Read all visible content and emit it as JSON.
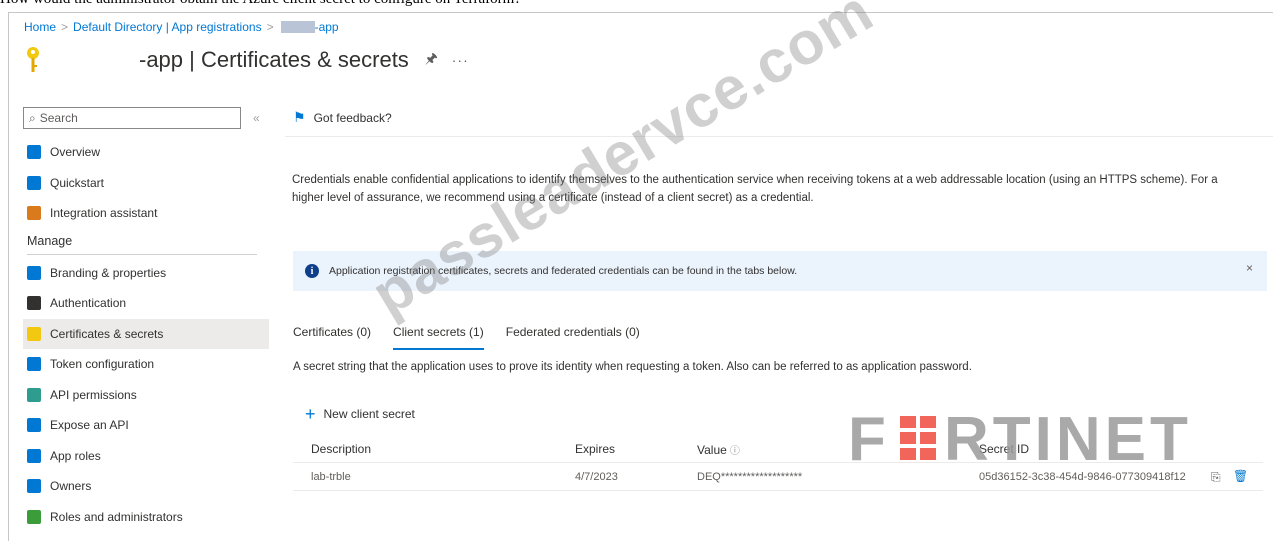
{
  "question": "How would the administrator obtain the Azure client secret to configure on Terraform?",
  "breadcrumb": {
    "home": "Home",
    "directory": "Default Directory | App registrations",
    "app": "-app"
  },
  "header": {
    "title": "-app | Certificates & secrets",
    "pin_icon": "pin-icon",
    "more_label": "···"
  },
  "sidebar": {
    "search_placeholder": "Search",
    "collapse_label": "«",
    "items_top": [
      {
        "label": "Overview",
        "icon": "overview-icon",
        "color": "#0078d4"
      },
      {
        "label": "Quickstart",
        "icon": "quickstart-icon",
        "color": "#0078d4"
      },
      {
        "label": "Integration assistant",
        "icon": "rocket-icon",
        "color": "#d97b1c"
      }
    ],
    "section_manage": "Manage",
    "items_manage": [
      {
        "label": "Branding & properties",
        "icon": "branding-icon",
        "color": "#0078d4"
      },
      {
        "label": "Authentication",
        "icon": "authentication-icon",
        "color": "#323130"
      },
      {
        "label": "Certificates & secrets",
        "icon": "key-icon",
        "color": "#f2c811",
        "selected": true
      },
      {
        "label": "Token configuration",
        "icon": "token-icon",
        "color": "#0078d4"
      },
      {
        "label": "API permissions",
        "icon": "api-permissions-icon",
        "color": "#2e9d8f"
      },
      {
        "label": "Expose an API",
        "icon": "cloud-icon",
        "color": "#0078d4"
      },
      {
        "label": "App roles",
        "icon": "app-roles-icon",
        "color": "#0078d4"
      },
      {
        "label": "Owners",
        "icon": "owners-icon",
        "color": "#0078d4"
      },
      {
        "label": "Roles and administrators",
        "icon": "roles-icon",
        "color": "#3a9d3a"
      }
    ]
  },
  "main": {
    "feedback_label": "Got feedback?",
    "description": "Credentials enable confidential applications to identify themselves to the authentication service when receiving tokens at a web addressable location (using an HTTPS scheme). For a higher level of assurance, we recommend using a certificate (instead of a client secret) as a credential.",
    "info_message": "Application registration certificates, secrets and federated credentials can be found in the tabs below.",
    "info_close": "×",
    "tabs": [
      {
        "label": "Certificates (0)",
        "active": false
      },
      {
        "label": "Client secrets (1)",
        "active": true
      },
      {
        "label": "Federated credentials (0)",
        "active": false
      }
    ],
    "tab_description": "A secret string that the application uses to prove its identity when requesting a token. Also can be referred to as application password.",
    "new_secret_label": "New client secret",
    "table": {
      "headers": {
        "description": "Description",
        "expires": "Expires",
        "value": "Value",
        "secret_id": "Secret ID"
      },
      "rows": [
        {
          "description": "lab-trble",
          "expires": "4/7/2023",
          "value": "DEQ*******************",
          "secret_id": "05d36152-3c38-454d-9846-077309418f12"
        }
      ]
    }
  },
  "overlays": {
    "watermark": "passleadervce.com",
    "logo": "FORTINET"
  },
  "colors": {
    "accent": "#0078d4",
    "info_bar": "#ebf3fc",
    "selected_nav": "#edebe9",
    "fortinet_red": "#ee3124",
    "fortinet_grey": "#9b9b9b"
  }
}
